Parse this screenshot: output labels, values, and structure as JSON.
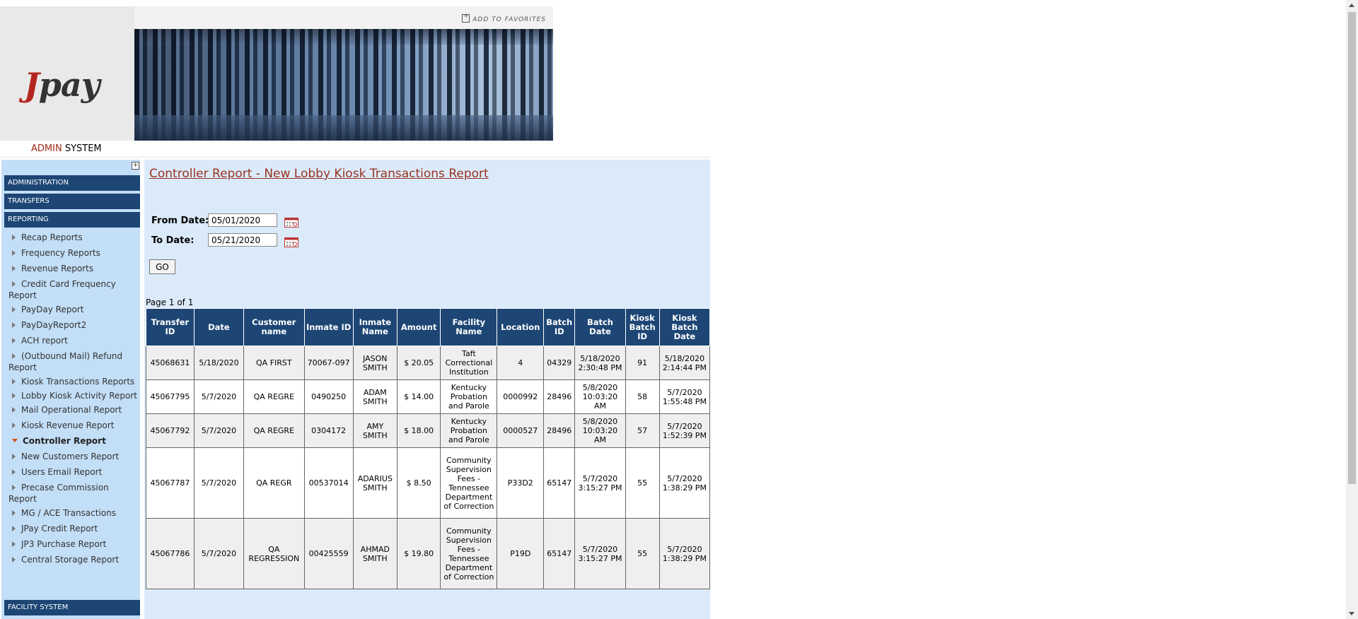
{
  "header": {
    "logo_j": "J",
    "logo_rest": "pay",
    "add_to_favorites": "ADD TO FAVORITES",
    "admin_red": "ADMIN",
    "admin_black": "SYSTEM"
  },
  "sidebar": {
    "collapse_symbol": "+",
    "sections": [
      "ADMINISTRATION",
      "TRANSFERS",
      "REPORTING",
      "FACILITY SYSTEM"
    ],
    "reporting_items": [
      "Recap Reports",
      "Frequency Reports",
      "Revenue Reports",
      "Credit Card Frequency Report",
      "PayDay Report",
      "PayDayReport2",
      "ACH report",
      "(Outbound Mail) Refund Report",
      "Kiosk Transactions Reports",
      "Lobby Kiosk Activity Report",
      "Mail Operational Report",
      "Kiosk Revenue Report",
      "Controller Report",
      "New Customers Report",
      "Users Email Report",
      "Precase Commission Report",
      "MG / ACE Transactions",
      "JPay Credit Report",
      "JP3 Purchase Report",
      "Central Storage Report"
    ],
    "active_item": "Controller Report"
  },
  "main": {
    "title": "Controller Report - New Lobby Kiosk Transactions Report",
    "from_label": "From Date:",
    "from_value": "05/01/2020",
    "to_label": "To Date:",
    "to_value": "05/21/2020",
    "go_label": "GO",
    "page_info": "Page 1 of 1",
    "columns": [
      "Transfer ID",
      "Date",
      "Customer name",
      "Inmate ID",
      "Inmate Name",
      "Amount",
      "Facility Name",
      "Location",
      "Batch ID",
      "Batch Date",
      "Kiosk Batch ID",
      "Kiosk Batch Date"
    ],
    "rows": [
      [
        "45068631",
        "5/18/2020",
        "QA FIRST",
        "70067-097",
        "JASON SMITH",
        "$ 20.05",
        "Taft Correctional Institution",
        "4",
        "04329",
        "5/18/2020 2:30:48 PM",
        "91",
        "5/18/2020 2:14:44 PM"
      ],
      [
        "45067795",
        "5/7/2020",
        "QA REGRE",
        "0490250",
        "ADAM SMITH",
        "$ 14.00",
        "Kentucky Probation and Parole",
        "0000992",
        "28496",
        "5/8/2020 10:03:20 AM",
        "58",
        "5/7/2020 1:55:48 PM"
      ],
      [
        "45067792",
        "5/7/2020",
        "QA REGRE",
        "0304172",
        "AMY SMITH",
        "$ 18.00",
        "Kentucky Probation and Parole",
        "0000527",
        "28496",
        "5/8/2020 10:03:20 AM",
        "57",
        "5/7/2020 1:52:39 PM"
      ],
      [
        "45067787",
        "5/7/2020",
        "QA REGR",
        "00537014",
        "ADARIUS SMITH",
        "$ 8.50",
        "Community Supervision Fees - Tennessee Department of Correction",
        "P33D2",
        "65147",
        "5/7/2020 3:15:27 PM",
        "55",
        "5/7/2020 1:38:29 PM"
      ],
      [
        "45067786",
        "5/7/2020",
        "QA REGRESSION",
        "00425559",
        "AHMAD SMITH",
        "$ 19.80",
        "Community Supervision Fees - Tennessee Department of Correction",
        "P19D",
        "65147",
        "5/7/2020 3:15:27 PM",
        "55",
        "5/7/2020 1:38:29 PM"
      ]
    ]
  },
  "colors": {
    "nav_dark": "#1d4675",
    "sidebar_bg": "#c3def7",
    "content_bg": "#dbeaf9",
    "brand_red": "#a52a1a"
  }
}
